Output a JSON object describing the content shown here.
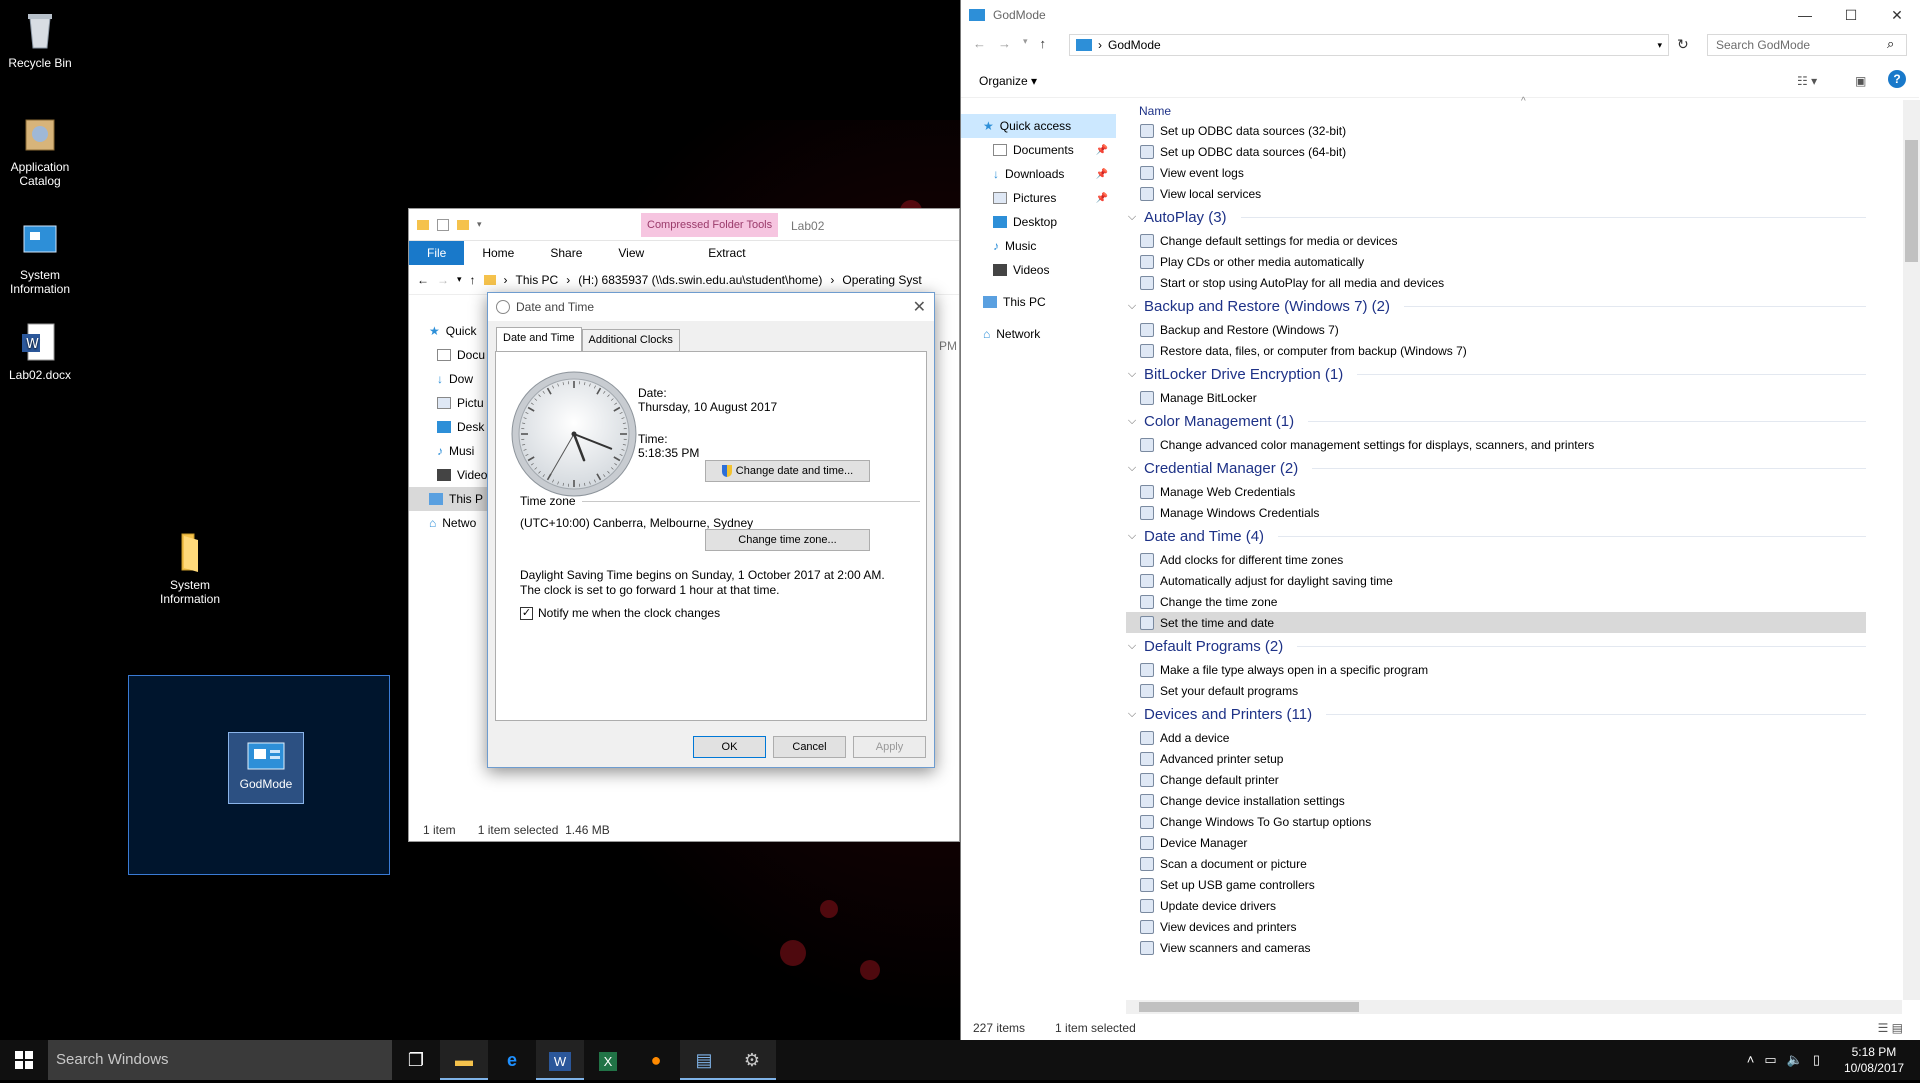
{
  "desktop": {
    "icons": [
      {
        "label": "Recycle Bin",
        "icon": "recycle-bin-icon"
      },
      {
        "label": "Application Catalog",
        "icon": "application-catalog-icon"
      },
      {
        "label": "System Information",
        "icon": "system-information-icon"
      },
      {
        "label": "Lab02.docx",
        "icon": "word-document-icon"
      },
      {
        "label": "System Information",
        "icon": "folder-icon"
      }
    ],
    "godmode_label": "GodMode"
  },
  "lab_window": {
    "tabs": [
      "File",
      "Home",
      "Share",
      "View"
    ],
    "context_tab": "Compressed Folder Tools",
    "context_sub": "Extract",
    "title": "Lab02",
    "breadcrumb": [
      "This PC",
      "(H:) 6835937 (\\\\ds.swin.edu.au\\student\\home)",
      "Operating Syst"
    ],
    "nav": [
      "Quick",
      "Docu",
      "Dow",
      "Pictu",
      "Desk",
      "Musi",
      "Video",
      "This P",
      "Netwo"
    ],
    "status_items": "1 item",
    "status_selected": "1 item selected  1.46 MB",
    "col_frag": "PM"
  },
  "dialog": {
    "title": "Date and Time",
    "tabs": [
      "Date and Time",
      "Additional Clocks"
    ],
    "date_label": "Date:",
    "date_value": "Thursday, 10 August 2017",
    "time_label": "Time:",
    "time_value": "5:18:35 PM",
    "change_dt": "Change date and time...",
    "tz_heading": "Time zone",
    "tz_value": "(UTC+10:00) Canberra, Melbourne, Sydney",
    "change_tz": "Change time zone...",
    "dst_text": "Daylight Saving Time begins on Sunday, 1 October 2017 at 2:00 AM. The clock is set to go forward 1 hour at that time.",
    "notify_label": "Notify me when the clock changes",
    "notify_checked": true,
    "ok": "OK",
    "cancel": "Cancel",
    "apply": "Apply",
    "clock": {
      "hour": 5,
      "minute": 18,
      "second": 35
    }
  },
  "godmode": {
    "title": "GodMode",
    "address": "GodMode",
    "search_placeholder": "Search GodMode",
    "organize": "Organize",
    "column_name": "Name",
    "nav": [
      {
        "label": "Quick access",
        "icon": "star-icon",
        "pinned": false,
        "selected": true
      },
      {
        "label": "Documents",
        "icon": "documents-icon",
        "pinned": true
      },
      {
        "label": "Downloads",
        "icon": "downloads-icon",
        "pinned": true
      },
      {
        "label": "Pictures",
        "icon": "pictures-icon",
        "pinned": true
      },
      {
        "label": "Desktop",
        "icon": "desktop-icon",
        "pinned": false
      },
      {
        "label": "Music",
        "icon": "music-icon",
        "pinned": false
      },
      {
        "label": "Videos",
        "icon": "videos-icon",
        "pinned": false
      },
      {
        "label": "This PC",
        "icon": "computer-icon",
        "pinned": false
      },
      {
        "label": "Network",
        "icon": "network-icon",
        "pinned": false
      }
    ],
    "list": [
      {
        "type": "item",
        "label": "Set up ODBC data sources (32-bit)"
      },
      {
        "type": "item",
        "label": "Set up ODBC data sources (64-bit)"
      },
      {
        "type": "item",
        "label": "View event logs"
      },
      {
        "type": "item",
        "label": "View local services"
      },
      {
        "type": "group",
        "label": "AutoPlay (3)"
      },
      {
        "type": "item",
        "label": "Change default settings for media or devices"
      },
      {
        "type": "item",
        "label": "Play CDs or other media automatically"
      },
      {
        "type": "item",
        "label": "Start or stop using AutoPlay for all media and devices"
      },
      {
        "type": "group",
        "label": "Backup and Restore (Windows 7) (2)"
      },
      {
        "type": "item",
        "label": "Backup and Restore (Windows 7)"
      },
      {
        "type": "item",
        "label": "Restore data, files, or computer from backup (Windows 7)"
      },
      {
        "type": "group",
        "label": "BitLocker Drive Encryption (1)"
      },
      {
        "type": "item",
        "label": "Manage BitLocker"
      },
      {
        "type": "group",
        "label": "Color Management (1)"
      },
      {
        "type": "item",
        "label": "Change advanced color management settings for displays, scanners, and printers"
      },
      {
        "type": "group",
        "label": "Credential Manager (2)"
      },
      {
        "type": "item",
        "label": "Manage Web Credentials"
      },
      {
        "type": "item",
        "label": "Manage Windows Credentials"
      },
      {
        "type": "group",
        "label": "Date and Time (4)"
      },
      {
        "type": "item",
        "label": "Add clocks for different time zones"
      },
      {
        "type": "item",
        "label": "Automatically adjust for daylight saving time"
      },
      {
        "type": "item",
        "label": "Change the time zone"
      },
      {
        "type": "item",
        "label": "Set the time and date",
        "selected": true
      },
      {
        "type": "group",
        "label": "Default Programs (2)"
      },
      {
        "type": "item",
        "label": "Make a file type always open in a specific program"
      },
      {
        "type": "item",
        "label": "Set your default programs"
      },
      {
        "type": "group",
        "label": "Devices and Printers (11)"
      },
      {
        "type": "item",
        "label": "Add a device"
      },
      {
        "type": "item",
        "label": "Advanced printer setup"
      },
      {
        "type": "item",
        "label": "Change default printer"
      },
      {
        "type": "item",
        "label": "Change device installation settings"
      },
      {
        "type": "item",
        "label": "Change Windows To Go startup options"
      },
      {
        "type": "item",
        "label": "Device Manager"
      },
      {
        "type": "item",
        "label": "Scan a document or picture"
      },
      {
        "type": "item",
        "label": "Set up USB game controllers"
      },
      {
        "type": "item",
        "label": "Update device drivers"
      },
      {
        "type": "item",
        "label": "View devices and printers"
      },
      {
        "type": "item",
        "label": "View scanners and cameras"
      }
    ],
    "status_count": "227 items",
    "status_selected": "1 item selected"
  },
  "taskbar": {
    "search_placeholder": "Search Windows",
    "apps": [
      "task-view-icon",
      "file-explorer-icon",
      "edge-icon",
      "word-icon",
      "excel-icon",
      "firefox-icon",
      "control-panel-icon",
      "settings-icon"
    ],
    "time": "5:18 PM",
    "date": "10/08/2017"
  },
  "colors": {
    "accent": "#1979ca",
    "group_heading": "#1e3287",
    "selection": "#cce8ff"
  }
}
